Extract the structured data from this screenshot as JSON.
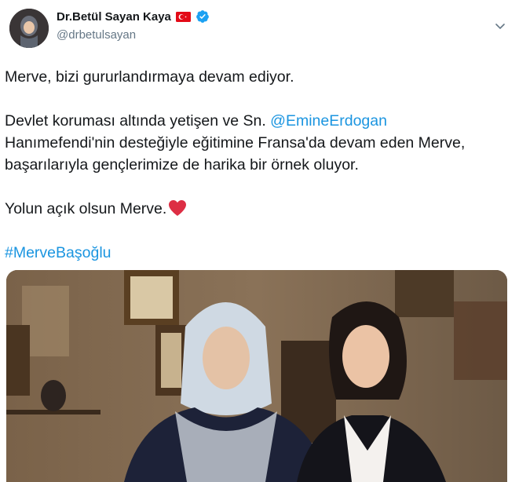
{
  "author": {
    "display_name": "Dr.Betül Sayan Kaya",
    "handle": "@drbetulsayan",
    "flag_icon": "turkey-flag-icon",
    "verified_icon": "verified-badge-icon",
    "verified_color": "#1da1f2"
  },
  "tweet": {
    "line1": "Merve, bizi gururlandırmaya devam ediyor.",
    "line2_prefix": "Devlet koruması altında yetişen ve Sn. ",
    "mention": "@EmineErdogan",
    "line2_rest": "Hanımefendi'nin desteğiyle eğitimine Fransa'da devam eden Merve, başarılarıyla gençlerimize de harika bir örnek oluyor.",
    "line3": "Yolun açık olsun Merve.",
    "heart_icon": "red-heart-emoji-icon",
    "hashtag": "#MerveBaşoğlu",
    "link_color": "#1b95e0"
  },
  "media": {
    "description_icon": "photo-two-women-icon"
  }
}
